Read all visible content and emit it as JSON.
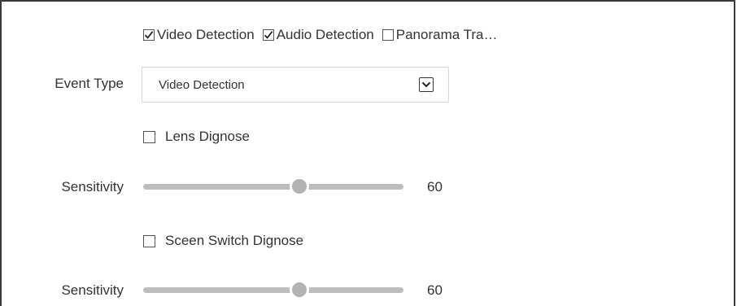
{
  "detection_options": [
    {
      "label": "Video Detection",
      "checked": true
    },
    {
      "label": "Audio Detection",
      "checked": true
    },
    {
      "label": "Panorama Tra…",
      "checked": false
    }
  ],
  "event_type": {
    "label": "Event Type",
    "selected": "Video Detection"
  },
  "lens_diagnose": {
    "label": "Lens Dignose",
    "checked": false
  },
  "lens_sensitivity": {
    "label": "Sensitivity",
    "value": "60",
    "max": 100
  },
  "screen_switch_diagnose": {
    "label": "Sceen Switch Dignose",
    "checked": false
  },
  "screen_switch_sensitivity": {
    "label": "Sensitivity",
    "value": "60",
    "max": 100
  },
  "colors": {
    "border": "#3a3a3a",
    "track": "#bdbdbd",
    "thumb": "#b3b3b3",
    "text": "#333333"
  },
  "icons": {
    "checked": "checkmark-icon",
    "dropdown": "chevron-down-icon"
  }
}
